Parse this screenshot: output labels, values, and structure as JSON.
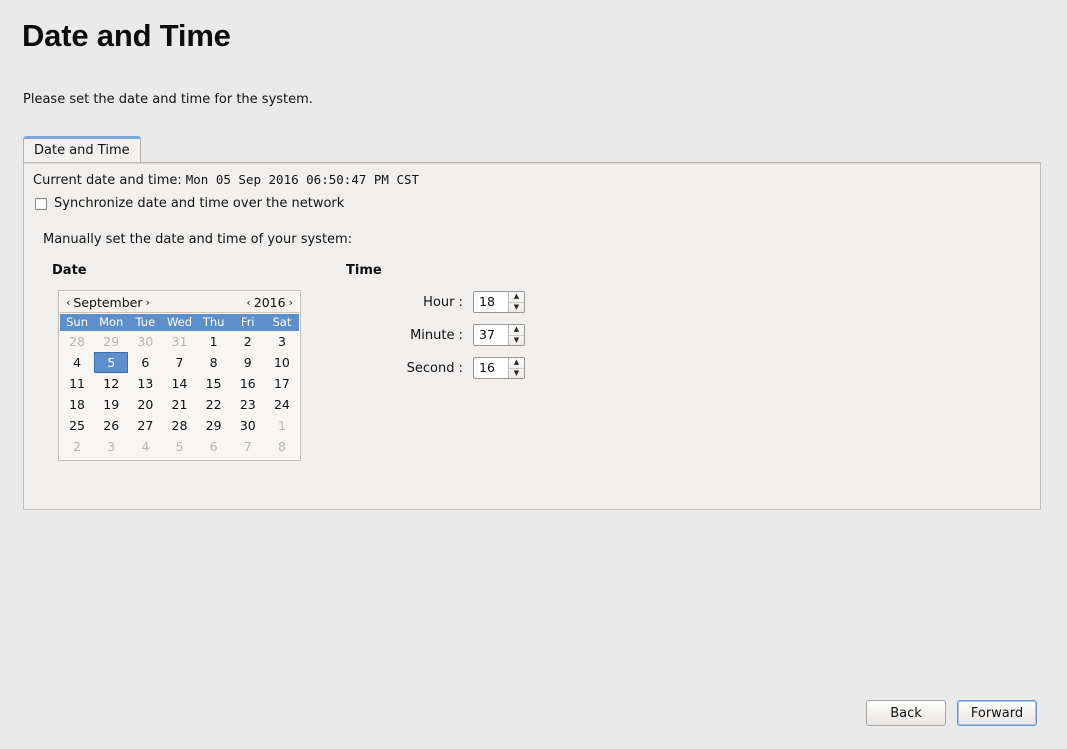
{
  "page": {
    "title": "Date and Time",
    "subtitle": "Please set the date and time for the system."
  },
  "tabs": [
    {
      "label": "Date and Time",
      "active": true
    }
  ],
  "panel": {
    "current_label": "Current date and time:",
    "current_value": "Mon 05 Sep 2016 06:50:47 PM CST",
    "sync_checkbox_label": "Synchronize date and time over the network",
    "sync_checked": false,
    "manual_label": "Manually set the date and time of your system:",
    "date_heading": "Date",
    "time_heading": "Time"
  },
  "calendar": {
    "month": "September",
    "year": "2016",
    "prev_month_arrow": "‹",
    "next_month_arrow": "›",
    "prev_year_arrow": "‹",
    "next_year_arrow": "›",
    "day_names": [
      "Sun",
      "Mon",
      "Tue",
      "Wed",
      "Thu",
      "Fri",
      "Sat"
    ],
    "selected_day": 5,
    "weeks": [
      [
        {
          "d": "28",
          "dim": true
        },
        {
          "d": "29",
          "dim": true
        },
        {
          "d": "30",
          "dim": true
        },
        {
          "d": "31",
          "dim": true
        },
        {
          "d": "1",
          "dim": false
        },
        {
          "d": "2",
          "dim": false
        },
        {
          "d": "3",
          "dim": false
        }
      ],
      [
        {
          "d": "4",
          "dim": false
        },
        {
          "d": "5",
          "dim": false,
          "selected": true
        },
        {
          "d": "6",
          "dim": false
        },
        {
          "d": "7",
          "dim": false
        },
        {
          "d": "8",
          "dim": false
        },
        {
          "d": "9",
          "dim": false
        },
        {
          "d": "10",
          "dim": false
        }
      ],
      [
        {
          "d": "11",
          "dim": false
        },
        {
          "d": "12",
          "dim": false
        },
        {
          "d": "13",
          "dim": false
        },
        {
          "d": "14",
          "dim": false
        },
        {
          "d": "15",
          "dim": false
        },
        {
          "d": "16",
          "dim": false
        },
        {
          "d": "17",
          "dim": false
        }
      ],
      [
        {
          "d": "18",
          "dim": false
        },
        {
          "d": "19",
          "dim": false
        },
        {
          "d": "20",
          "dim": false
        },
        {
          "d": "21",
          "dim": false
        },
        {
          "d": "22",
          "dim": false
        },
        {
          "d": "23",
          "dim": false
        },
        {
          "d": "24",
          "dim": false
        }
      ],
      [
        {
          "d": "25",
          "dim": false
        },
        {
          "d": "26",
          "dim": false
        },
        {
          "d": "27",
          "dim": false
        },
        {
          "d": "28",
          "dim": false
        },
        {
          "d": "29",
          "dim": false
        },
        {
          "d": "30",
          "dim": false
        },
        {
          "d": "1",
          "dim": true
        }
      ],
      [
        {
          "d": "2",
          "dim": true
        },
        {
          "d": "3",
          "dim": true
        },
        {
          "d": "4",
          "dim": true
        },
        {
          "d": "5",
          "dim": true
        },
        {
          "d": "6",
          "dim": true
        },
        {
          "d": "7",
          "dim": true
        },
        {
          "d": "8",
          "dim": true
        }
      ]
    ]
  },
  "time": {
    "hour_label": "Hour :",
    "hour_value": "18",
    "minute_label": "Minute :",
    "minute_value": "37",
    "second_label": "Second :",
    "second_value": "16",
    "spin_up_arrow": "▲",
    "spin_down_arrow": "▼"
  },
  "footer": {
    "back_label": "Back",
    "forward_label": "Forward",
    "focused_button": "Forward"
  },
  "colors": {
    "accent_blue": "#5d8fcc",
    "tab_accent": "#7ca7d8",
    "window_bg": "#ebeaea",
    "panel_bg": "#f2f0ef",
    "focus_border": "#6b95c9"
  }
}
